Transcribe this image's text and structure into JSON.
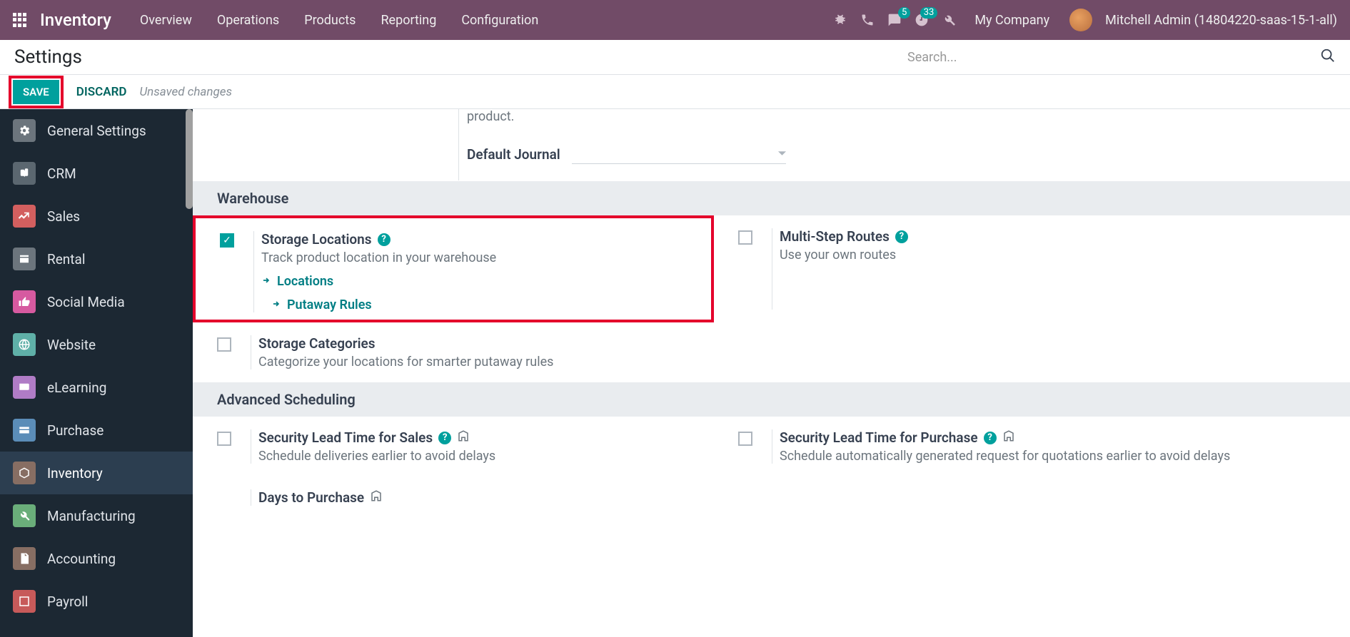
{
  "nav": {
    "brand": "Inventory",
    "links": [
      "Overview",
      "Operations",
      "Products",
      "Reporting",
      "Configuration"
    ],
    "messages_badge": "5",
    "activities_badge": "33",
    "company": "My Company",
    "user": "Mitchell Admin (14804220-saas-15-1-all)"
  },
  "page": {
    "title": "Settings",
    "search_placeholder": "Search..."
  },
  "actions": {
    "save": "SAVE",
    "discard": "DISCARD",
    "unsaved": "Unsaved changes"
  },
  "sidebar": {
    "items": [
      {
        "label": "General Settings",
        "color": "#6c757d"
      },
      {
        "label": "CRM",
        "color": "#5b6770"
      },
      {
        "label": "Sales",
        "color": "#d35f5f"
      },
      {
        "label": "Rental",
        "color": "#6c757d"
      },
      {
        "label": "Social Media",
        "color": "#d65aa0"
      },
      {
        "label": "Website",
        "color": "#5fb0a8"
      },
      {
        "label": "eLearning",
        "color": "#b07cc6"
      },
      {
        "label": "Purchase",
        "color": "#5b8db8"
      },
      {
        "label": "Inventory",
        "color": "#876e63"
      },
      {
        "label": "Manufacturing",
        "color": "#6aae7a"
      },
      {
        "label": "Accounting",
        "color": "#876e63"
      },
      {
        "label": "Payroll",
        "color": "#c75a5a"
      }
    ]
  },
  "pre": {
    "text": "product.",
    "journal_label": "Default Journal"
  },
  "sections": {
    "warehouse": {
      "title": "Warehouse"
    },
    "adv": {
      "title": "Advanced Scheduling"
    }
  },
  "settings": {
    "storage_loc": {
      "title": "Storage Locations",
      "desc": "Track product location in your warehouse",
      "link1": "Locations",
      "link2": "Putaway Rules"
    },
    "multi_step": {
      "title": "Multi-Step Routes",
      "desc": "Use your own routes"
    },
    "storage_cat": {
      "title": "Storage Categories",
      "desc": "Categorize your locations for smarter putaway rules"
    },
    "slt_sales": {
      "title": "Security Lead Time for Sales",
      "desc": "Schedule deliveries earlier to avoid delays"
    },
    "slt_purchase": {
      "title": "Security Lead Time for Purchase",
      "desc": "Schedule automatically generated request for quotations earlier to avoid delays"
    },
    "days_purchase": {
      "title": "Days to Purchase"
    }
  }
}
